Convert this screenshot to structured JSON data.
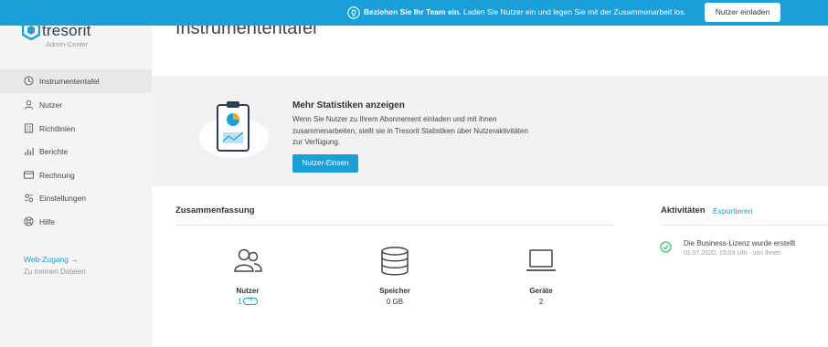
{
  "banner": {
    "strong": "Beziehen Sie Ihr Team ein.",
    "text": " Laden Sie Nutzer ein und legen Sie mit der Zusammenarbeit los.",
    "button": "Nutzer einladen",
    "icon": "lightbulb-icon"
  },
  "brand": {
    "name": "tresorit",
    "subtitle": "Admin-Center"
  },
  "sidebar": {
    "items": [
      {
        "label": "Instrumententafel",
        "icon": "dashboard-icon",
        "active": true
      },
      {
        "label": "Nutzer",
        "icon": "user-icon"
      },
      {
        "label": "Richtlinien",
        "icon": "policy-icon"
      },
      {
        "label": "Berichte",
        "icon": "bar-chart-icon"
      },
      {
        "label": "Rechnung",
        "icon": "credit-card-icon"
      },
      {
        "label": "Einstellungen",
        "icon": "settings-icon"
      },
      {
        "label": "Hilfe",
        "icon": "help-icon"
      }
    ],
    "web_access": "Web-Zugang →",
    "web_access_sub": "Zu meinen Dateien"
  },
  "page": {
    "title": "Instrumententafel"
  },
  "promo": {
    "title": "Mehr Statistiken anzeigen",
    "text": "Wenn Sie Nutzer zu Ihrem Abonnement einladen und mit ihnen zusammenarbeiten, stellt sie in Tresorit Statistiken über Nutzeraktivitäten zur Verfügung.",
    "button": "Nutzer-Einsen"
  },
  "summary": {
    "heading": "Zusammenfassung",
    "stats": [
      {
        "label": "Nutzer",
        "value": "1",
        "icon": "users-icon"
      },
      {
        "label": "Speicher",
        "value": "0 GB",
        "icon": "database-icon"
      },
      {
        "label": "Geräte",
        "value": "2",
        "icon": "laptop-icon"
      }
    ]
  },
  "activity": {
    "heading": "Aktivitäten",
    "export": "Exportieren",
    "items": [
      {
        "title": "Die Business-Lizenz wurde erstellt",
        "meta": "01.07.2020, 15:03 Uhr · von Ihnen"
      }
    ]
  },
  "colors": {
    "accent": "#1a9fd9",
    "sidebar": "#f4f4f4",
    "success": "#2ecc71"
  }
}
